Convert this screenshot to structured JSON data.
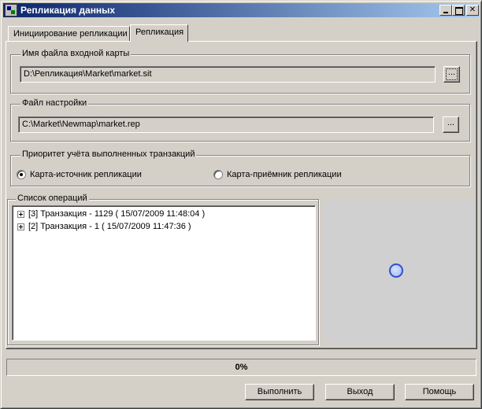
{
  "window": {
    "title": "Репликация данных",
    "controls": {
      "minimize": "_",
      "maximize": "□",
      "close": "✕"
    }
  },
  "tabs": [
    {
      "label": "Инициирование репликации",
      "active": false
    },
    {
      "label": "Репликация",
      "active": true
    }
  ],
  "input_map": {
    "label": "Имя файла входной карты",
    "value": "D:\\Репликация\\Market\\market.sit",
    "browse_label": "..."
  },
  "settings_file": {
    "label": "Файл настройки",
    "value": "C:\\Market\\Newmap\\market.rep",
    "browse_label": "..."
  },
  "priority": {
    "label": "Приоритет учёта выполненных транзакций",
    "options": [
      {
        "label": "Карта-источник репликации",
        "checked": true
      },
      {
        "label": "Карта-приёмник репликации",
        "checked": false
      }
    ]
  },
  "operations": {
    "label": "Список операций",
    "items": [
      "[3] Транзакция - 1129 ( 15/07/2009  11:48:04 )",
      "[2] Транзакция - 1 ( 15/07/2009  11:47:36 )"
    ]
  },
  "progress": {
    "value": 0,
    "text": "0%"
  },
  "buttons": {
    "run": "Выполнить",
    "exit": "Выход",
    "help": "Помощь"
  },
  "colors": {
    "titlebar_start": "#0a246a",
    "titlebar_end": "#a6caf0",
    "face": "#d4d0c8",
    "spinner": "#3050d0"
  }
}
